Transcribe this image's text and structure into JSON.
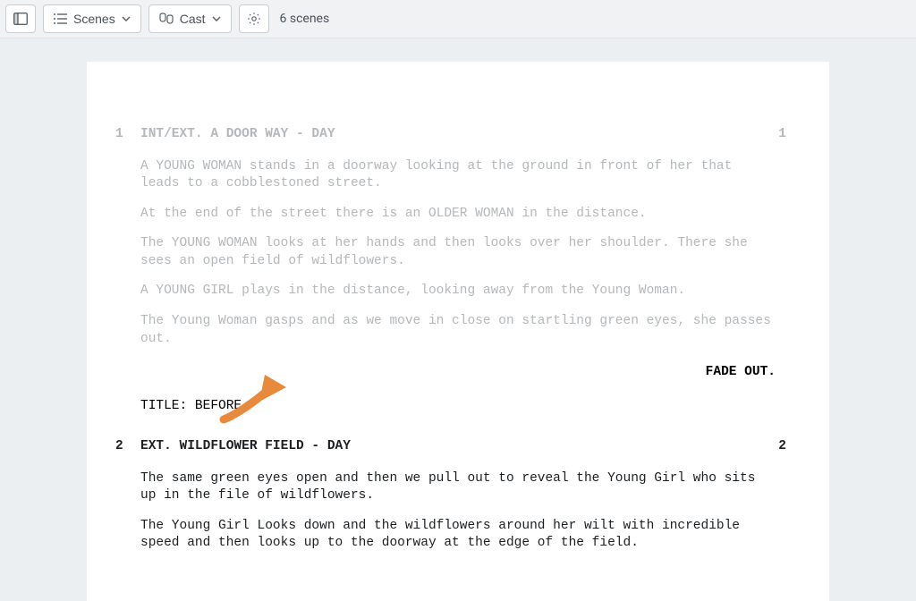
{
  "toolbar": {
    "scenes_label": "Scenes",
    "cast_label": "Cast",
    "scene_count": "6 scenes"
  },
  "script": {
    "scene1": {
      "num_left": "1",
      "num_right": "1",
      "heading": "INT/EXT. A DOOR WAY - DAY",
      "p1": "A YOUNG WOMAN stands in a doorway looking at the ground in front of her that leads to a cobblestoned street.",
      "p2": "At the end of the street there is an OLDER WOMAN in the distance.",
      "p3": "The YOUNG WOMAN looks at her hands and then looks over her shoulder. There she sees an open field of wildflowers.",
      "p4": "A YOUNG GIRL plays in the distance, looking away from the Young Woman.",
      "p5": "The Young Woman gasps and as we move in close on startling green eyes, she passes out."
    },
    "transition1": "FADE OUT.",
    "title_card": "TITLE: BEFORE",
    "scene2": {
      "num_left": "2",
      "num_right": "2",
      "heading": "EXT. WILDFLOWER FIELD - DAY",
      "p1": "The same green eyes open and then we pull out to reveal the Young Girl who sits up in the file of wildflowers.",
      "p2": "The Young Girl Looks down and the wildflowers around her wilt with incredible speed and then looks up to the doorway at the edge of the field."
    }
  }
}
